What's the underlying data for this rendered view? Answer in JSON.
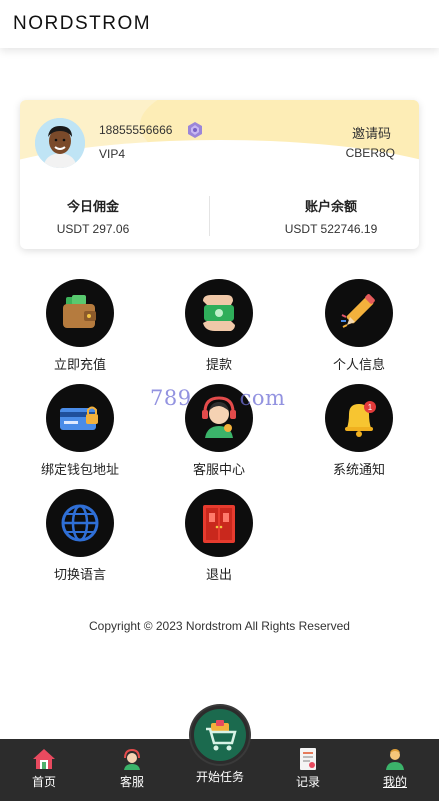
{
  "brand": {
    "logo": "NORDSTROM"
  },
  "profile": {
    "phone": "18855556666",
    "vip_level": "VIP4",
    "invite_label": "邀请码",
    "invite_code": "CBER8Q"
  },
  "stats": {
    "commission_label": "今日佣金",
    "commission_value": "USDT 297.06",
    "balance_label": "账户余额",
    "balance_value": "USDT 522746.19"
  },
  "menu": [
    {
      "label": "立即充值",
      "icon": "wallet-icon"
    },
    {
      "label": "提款",
      "icon": "cash-hand-icon"
    },
    {
      "label": "个人信息",
      "icon": "pencil-icon"
    },
    {
      "label": "绑定钱包地址",
      "icon": "card-lock-icon"
    },
    {
      "label": "客服中心",
      "icon": "support-agent-icon"
    },
    {
      "label": "系统通知",
      "icon": "bell-icon"
    },
    {
      "label": "切换语言",
      "icon": "globe-icon"
    },
    {
      "label": "退出",
      "icon": "door-icon"
    }
  ],
  "watermark": "789",
  "watermark_tail": "com",
  "footer": {
    "copyright": "Copyright © 2023 Nordstrom All Rights Reserved"
  },
  "bottom_nav": {
    "home": "首页",
    "service": "客服",
    "start_task": "开始任务",
    "records": "记录",
    "mine": "我的"
  },
  "colors": {
    "nav_bg": "#2c2c2c",
    "card_accent": "#fdf1c9",
    "center_btn": "#1b6a4e"
  }
}
